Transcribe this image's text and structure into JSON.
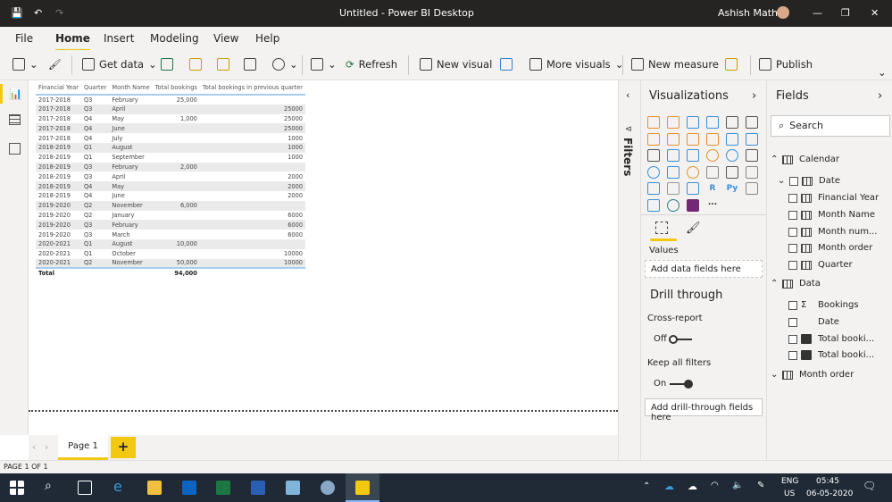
{
  "window": {
    "title": "Untitled - Power BI Desktop",
    "user": "Ashish Mathur"
  },
  "menu": [
    "File",
    "Home",
    "Insert",
    "Modeling",
    "View",
    "Help"
  ],
  "ribbon": {
    "get_data": "Get data",
    "refresh": "Refresh",
    "new_visual": "New visual",
    "more_visuals": "More visuals",
    "new_measure": "New measure",
    "publish": "Publish"
  },
  "table": {
    "headers": [
      "Financial Year",
      "Quarter",
      "Month Name",
      "Total bookings",
      "Total bookings in previous quarter"
    ],
    "rows": [
      [
        "2017-2018",
        "Q3",
        "February",
        "25,000",
        ""
      ],
      [
        "2017-2018",
        "Q3",
        "April",
        "",
        "25000"
      ],
      [
        "2017-2018",
        "Q4",
        "May",
        "1,000",
        "25000"
      ],
      [
        "2017-2018",
        "Q4",
        "June",
        "",
        "25000"
      ],
      [
        "2017-2018",
        "Q4",
        "July",
        "",
        "1000"
      ],
      [
        "2018-2019",
        "Q1",
        "August",
        "",
        "1000"
      ],
      [
        "2018-2019",
        "Q1",
        "September",
        "",
        "1000"
      ],
      [
        "2018-2019",
        "Q3",
        "February",
        "2,000",
        ""
      ],
      [
        "2018-2019",
        "Q3",
        "April",
        "",
        "2000"
      ],
      [
        "2018-2019",
        "Q4",
        "May",
        "",
        "2000"
      ],
      [
        "2018-2019",
        "Q4",
        "June",
        "",
        "2000"
      ],
      [
        "2019-2020",
        "Q2",
        "November",
        "6,000",
        ""
      ],
      [
        "2019-2020",
        "Q2",
        "January",
        "",
        "6000"
      ],
      [
        "2019-2020",
        "Q3",
        "February",
        "",
        "6000"
      ],
      [
        "2019-2020",
        "Q3",
        "March",
        "",
        "6000"
      ],
      [
        "2020-2021",
        "Q1",
        "August",
        "10,000",
        ""
      ],
      [
        "2020-2021",
        "Q1",
        "October",
        "",
        "10000"
      ],
      [
        "2020-2021",
        "Q2",
        "November",
        "50,000",
        "10000"
      ]
    ],
    "total": {
      "label": "Total",
      "bookings": "94,000"
    }
  },
  "filters": {
    "label": "Filters"
  },
  "visualizations": {
    "title": "Visualizations",
    "values_label": "Values",
    "add_fields": "Add data fields here",
    "drill_title": "Drill through",
    "cross_report": "Cross-report",
    "cross_report_state": "Off",
    "keep_filters": "Keep all filters",
    "keep_filters_state": "On",
    "add_drill": "Add drill-through fields here",
    "more": "..."
  },
  "fields": {
    "title": "Fields",
    "search_placeholder": "Search",
    "items": [
      {
        "label": "Calendar"
      },
      {
        "label": "Date"
      },
      {
        "label": "Financial Year"
      },
      {
        "label": "Month Name"
      },
      {
        "label": "Month num..."
      },
      {
        "label": "Month order"
      },
      {
        "label": "Quarter"
      },
      {
        "label": "Data"
      },
      {
        "label": "Bookings"
      },
      {
        "label": "Date"
      },
      {
        "label": "Total booki..."
      },
      {
        "label": "Total booki..."
      },
      {
        "label": "Month order"
      }
    ]
  },
  "pages": {
    "tab": "Page 1",
    "add": "+"
  },
  "status": "PAGE 1 OF 1",
  "taskbar": {
    "lang": "ENG",
    "region": "US",
    "time": "05:45",
    "date": "06-05-2020"
  },
  "colors": {
    "accent": "#f2c811",
    "titlebar": "#252423",
    "taskbar": "#1f2a36"
  }
}
